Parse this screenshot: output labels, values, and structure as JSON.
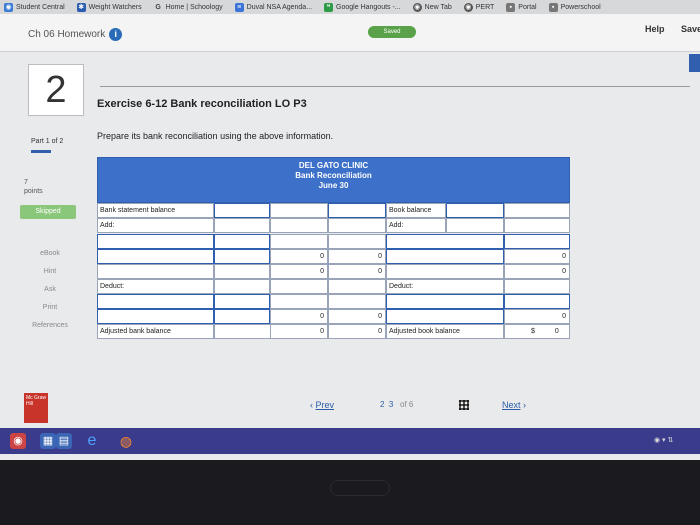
{
  "bookmarks": [
    {
      "label": "Student Central",
      "icon": "student-central-icon",
      "color": "#3b7bd6"
    },
    {
      "label": "Weight Watchers",
      "icon": "weight-watchers-icon",
      "color": "#2a5db0"
    },
    {
      "label": "Home | Schoology",
      "icon": "google-g-icon",
      "color": "#4a4a4a"
    },
    {
      "label": "Duval NSA Agenda...",
      "icon": "docs-icon",
      "color": "#3a74d8"
    },
    {
      "label": "Google Hangouts -...",
      "icon": "hangouts-icon",
      "color": "#2e9b47"
    },
    {
      "label": "New Tab",
      "icon": "new-tab-icon",
      "color": "#555"
    },
    {
      "label": "PERT",
      "icon": "pert-icon",
      "color": "#555"
    },
    {
      "label": "Portal",
      "icon": "portal-icon",
      "color": "#777"
    },
    {
      "label": "Powerschool",
      "icon": "powerschool-icon",
      "color": "#777"
    }
  ],
  "header": {
    "homework_title": "Ch 06 Homework",
    "saved_label": "Saved",
    "help_label": "Help",
    "save_label": "Save"
  },
  "question": {
    "number": "2",
    "title": "Exercise 6-12 Bank reconciliation LO P3",
    "part": "Part 1 of 2",
    "instructions": "Prepare its bank reconciliation using the above information.",
    "points_value": "7",
    "points_label": "points",
    "skipped_label": "Skipped"
  },
  "side_links": [
    "eBook",
    "Hint",
    "Ask",
    "Print",
    "References"
  ],
  "reconciliation": {
    "company": "DEL GATO CLINIC",
    "title": "Bank Reconciliation",
    "date": "June 30",
    "bank_balance_label": "Bank statement balance",
    "book_balance_label": "Book balance",
    "add_label": "Add:",
    "deduct_label": "Deduct:",
    "adjusted_bank_label": "Adjusted bank balance",
    "adjusted_book_label": "Adjusted book balance",
    "currency": "$",
    "bank_add_total": "0",
    "bank_subtotal": "0",
    "bank_deduct_total": "0",
    "adjusted_bank_value": "0",
    "book_add_total": "0",
    "book_subtotal": "0",
    "book_deduct_total": "0",
    "adjusted_book_value": "0"
  },
  "navigation": {
    "prev_label": "Prev",
    "next_label": "Next",
    "page_current": "2",
    "page_next": "3",
    "page_of": "of 6"
  },
  "publisher": {
    "logo_text": "Mc Graw Hill"
  }
}
